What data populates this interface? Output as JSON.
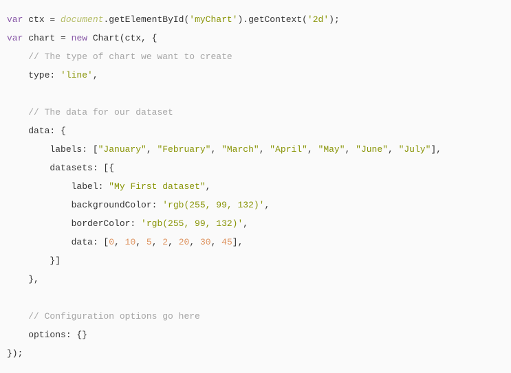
{
  "code": {
    "tokens": [
      [
        {
          "c": "kw",
          "t": "var"
        },
        {
          "c": "punc",
          "t": " "
        },
        {
          "c": "ident",
          "t": "ctx"
        },
        {
          "c": "punc",
          "t": " = "
        },
        {
          "c": "glob",
          "t": "document"
        },
        {
          "c": "punc",
          "t": ".getElementById("
        },
        {
          "c": "str",
          "t": "'myChart'"
        },
        {
          "c": "punc",
          "t": ").getContext("
        },
        {
          "c": "str",
          "t": "'2d'"
        },
        {
          "c": "punc",
          "t": ");"
        }
      ],
      [
        {
          "c": "kw",
          "t": "var"
        },
        {
          "c": "punc",
          "t": " "
        },
        {
          "c": "ident",
          "t": "chart"
        },
        {
          "c": "punc",
          "t": " = "
        },
        {
          "c": "kw",
          "t": "new"
        },
        {
          "c": "punc",
          "t": " Chart(ctx, {"
        }
      ],
      [
        {
          "c": "punc",
          "t": "    "
        },
        {
          "c": "cmt",
          "t": "// The type of chart we want to create"
        }
      ],
      [
        {
          "c": "punc",
          "t": "    type: "
        },
        {
          "c": "str",
          "t": "'line'"
        },
        {
          "c": "punc",
          "t": ","
        }
      ],
      [
        {
          "c": "punc",
          "t": ""
        }
      ],
      [
        {
          "c": "punc",
          "t": "    "
        },
        {
          "c": "cmt",
          "t": "// The data for our dataset"
        }
      ],
      [
        {
          "c": "punc",
          "t": "    data: {"
        }
      ],
      [
        {
          "c": "punc",
          "t": "        labels: ["
        },
        {
          "c": "str",
          "t": "\"January\""
        },
        {
          "c": "punc",
          "t": ", "
        },
        {
          "c": "str",
          "t": "\"February\""
        },
        {
          "c": "punc",
          "t": ", "
        },
        {
          "c": "str",
          "t": "\"March\""
        },
        {
          "c": "punc",
          "t": ", "
        },
        {
          "c": "str",
          "t": "\"April\""
        },
        {
          "c": "punc",
          "t": ", "
        },
        {
          "c": "str",
          "t": "\"May\""
        },
        {
          "c": "punc",
          "t": ", "
        },
        {
          "c": "str",
          "t": "\"June\""
        },
        {
          "c": "punc",
          "t": ", "
        },
        {
          "c": "str",
          "t": "\"July\""
        },
        {
          "c": "punc",
          "t": "],"
        }
      ],
      [
        {
          "c": "punc",
          "t": "        datasets: [{"
        }
      ],
      [
        {
          "c": "punc",
          "t": "            label: "
        },
        {
          "c": "str",
          "t": "\"My First dataset\""
        },
        {
          "c": "punc",
          "t": ","
        }
      ],
      [
        {
          "c": "punc",
          "t": "            backgroundColor: "
        },
        {
          "c": "str",
          "t": "'rgb(255, 99, 132)'"
        },
        {
          "c": "punc",
          "t": ","
        }
      ],
      [
        {
          "c": "punc",
          "t": "            borderColor: "
        },
        {
          "c": "str",
          "t": "'rgb(255, 99, 132)'"
        },
        {
          "c": "punc",
          "t": ","
        }
      ],
      [
        {
          "c": "punc",
          "t": "            data: ["
        },
        {
          "c": "num",
          "t": "0"
        },
        {
          "c": "punc",
          "t": ", "
        },
        {
          "c": "num",
          "t": "10"
        },
        {
          "c": "punc",
          "t": ", "
        },
        {
          "c": "num",
          "t": "5"
        },
        {
          "c": "punc",
          "t": ", "
        },
        {
          "c": "num",
          "t": "2"
        },
        {
          "c": "punc",
          "t": ", "
        },
        {
          "c": "num",
          "t": "20"
        },
        {
          "c": "punc",
          "t": ", "
        },
        {
          "c": "num",
          "t": "30"
        },
        {
          "c": "punc",
          "t": ", "
        },
        {
          "c": "num",
          "t": "45"
        },
        {
          "c": "punc",
          "t": "],"
        }
      ],
      [
        {
          "c": "punc",
          "t": "        }]"
        }
      ],
      [
        {
          "c": "punc",
          "t": "    },"
        }
      ],
      [
        {
          "c": "punc",
          "t": ""
        }
      ],
      [
        {
          "c": "punc",
          "t": "    "
        },
        {
          "c": "cmt",
          "t": "// Configuration options go here"
        }
      ],
      [
        {
          "c": "punc",
          "t": "    options: {}"
        }
      ],
      [
        {
          "c": "punc",
          "t": "});"
        }
      ]
    ]
  }
}
